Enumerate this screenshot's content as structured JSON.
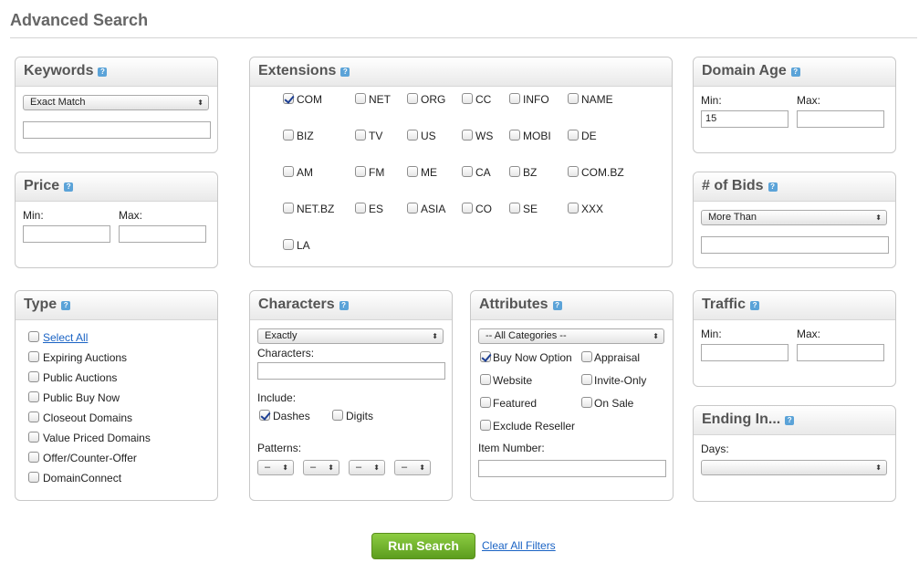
{
  "page": {
    "title": "Advanced Search",
    "help_glyph": "?"
  },
  "keywords": {
    "title": "Keywords",
    "match_select": "Exact Match",
    "keyword_value": ""
  },
  "price": {
    "title": "Price",
    "min_label": "Min:",
    "max_label": "Max:",
    "min_value": "",
    "max_value": ""
  },
  "extensions": {
    "title": "Extensions",
    "items": [
      {
        "label": "COM",
        "checked": true
      },
      {
        "label": "NET",
        "checked": false
      },
      {
        "label": "ORG",
        "checked": false
      },
      {
        "label": "CC",
        "checked": false
      },
      {
        "label": "INFO",
        "checked": false
      },
      {
        "label": "NAME",
        "checked": false
      },
      {
        "label": "BIZ",
        "checked": false
      },
      {
        "label": "TV",
        "checked": false
      },
      {
        "label": "US",
        "checked": false
      },
      {
        "label": "WS",
        "checked": false
      },
      {
        "label": "MOBI",
        "checked": false
      },
      {
        "label": "DE",
        "checked": false
      },
      {
        "label": "AM",
        "checked": false
      },
      {
        "label": "FM",
        "checked": false
      },
      {
        "label": "ME",
        "checked": false
      },
      {
        "label": "CA",
        "checked": false
      },
      {
        "label": "BZ",
        "checked": false
      },
      {
        "label": "COM.BZ",
        "checked": false
      },
      {
        "label": "NET.BZ",
        "checked": false
      },
      {
        "label": "ES",
        "checked": false
      },
      {
        "label": "ASIA",
        "checked": false
      },
      {
        "label": "CO",
        "checked": false
      },
      {
        "label": "SE",
        "checked": false
      },
      {
        "label": "XXX",
        "checked": false
      },
      {
        "label": "LA",
        "checked": false
      }
    ]
  },
  "domain_age": {
    "title": "Domain Age",
    "min_label": "Min:",
    "max_label": "Max:",
    "min_value": "15",
    "max_value": ""
  },
  "bids": {
    "title": "# of Bids",
    "select": "More Than",
    "value": ""
  },
  "type": {
    "title": "Type",
    "items": [
      {
        "label": "Select All",
        "checked": false,
        "link": true
      },
      {
        "label": "Expiring Auctions",
        "checked": false
      },
      {
        "label": "Public Auctions",
        "checked": false
      },
      {
        "label": "Public Buy Now",
        "checked": false
      },
      {
        "label": "Closeout Domains",
        "checked": false
      },
      {
        "label": "Value Priced Domains",
        "checked": false
      },
      {
        "label": "Offer/Counter-Offer",
        "checked": false
      },
      {
        "label": "DomainConnect",
        "checked": false
      }
    ]
  },
  "characters": {
    "title": "Characters",
    "mode_select": "Exactly",
    "characters_label": "Characters:",
    "characters_value": "",
    "include_label": "Include:",
    "dashes_label": "Dashes",
    "dashes_checked": true,
    "digits_label": "Digits",
    "digits_checked": false,
    "patterns_label": "Patterns:",
    "patterns": [
      "–",
      "–",
      "–",
      "–"
    ]
  },
  "attributes": {
    "title": "Attributes",
    "category_select": "-- All Categories --",
    "items": [
      {
        "label": "Buy Now Option",
        "checked": true
      },
      {
        "label": "Appraisal",
        "checked": false
      },
      {
        "label": "Website",
        "checked": false
      },
      {
        "label": "Invite-Only",
        "checked": false
      },
      {
        "label": "Featured",
        "checked": false
      },
      {
        "label": "On Sale",
        "checked": false
      },
      {
        "label": "Exclude Reseller",
        "checked": false
      }
    ],
    "item_number_label": "Item Number:",
    "item_number_value": ""
  },
  "traffic": {
    "title": "Traffic",
    "min_label": "Min:",
    "max_label": "Max:",
    "min_value": "",
    "max_value": ""
  },
  "ending": {
    "title": "Ending In...",
    "days_label": "Days:",
    "days_select": ""
  },
  "actions": {
    "run_label": "Run Search",
    "clear_label": "Clear All Filters"
  },
  "icons": {
    "select_arrow": "⬍"
  },
  "colors": {
    "run_button": "#6aad2a",
    "link": "#1a63c4",
    "help_icon": "#5ba3d8",
    "checkmark": "#1c3f94"
  }
}
